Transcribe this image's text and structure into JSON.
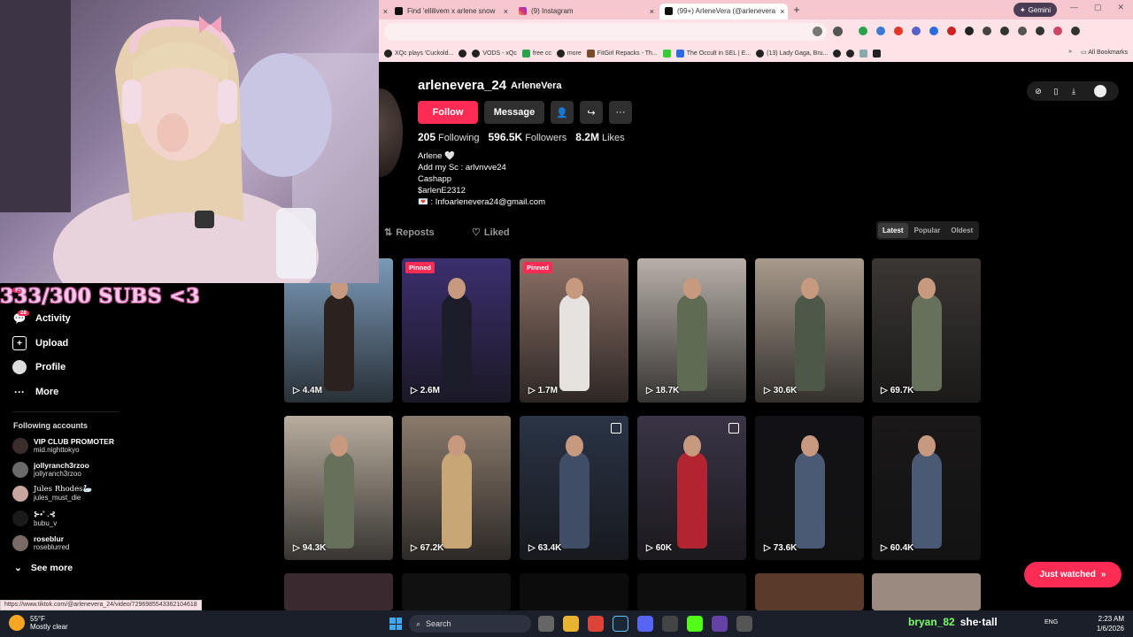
{
  "browser": {
    "tabs": [
      {
        "label": "Find 'ellilivem x arlene snow"
      },
      {
        "label": "(9) Instagram"
      },
      {
        "label": "(99+) ArleneVera (@arlenevera"
      }
    ],
    "gemini_label": "Gemini",
    "bookmarks": [
      "XQc plays 'Cuckold...",
      "VODS - xQc",
      "free cc",
      "more",
      "FitGirl Repacks - Th...",
      "The Occult in SEL | E...",
      "(13) Lady Gaga, Bru..."
    ],
    "all_bookmarks": "All Bookmarks",
    "status_url": "https://www.tiktok.com/@arlenevera_24/video/7296985543362104618"
  },
  "profile": {
    "username": "arlenevera_24",
    "nickname": "ArleneVera",
    "follow_label": "Follow",
    "message_label": "Message",
    "stats": {
      "following_count": "205",
      "following_label": "Following",
      "followers_count": "596.5K",
      "followers_label": "Followers",
      "likes_count": "8.2M",
      "likes_label": "Likes"
    },
    "bio": [
      "Arlene 🤍",
      "Add my Sc : arlvnvve24",
      "Cashapp",
      "$arlenE2312",
      "💌 : Infoarlenevera24@gmail.com"
    ],
    "tabs": {
      "reposts": "Reposts",
      "liked": "Liked"
    },
    "sort": {
      "latest": "Latest",
      "popular": "Popular",
      "oldest": "Oldest"
    }
  },
  "videos": [
    {
      "views": "4.4M",
      "pinned": "",
      "multi": false,
      "bg": "#7a9ab8",
      "fig": "#2b2220"
    },
    {
      "views": "2.6M",
      "pinned": "Pinned",
      "multi": false,
      "bg": "#3c2f6e",
      "fig": "#1c1c2a"
    },
    {
      "views": "1.7M",
      "pinned": "Pinned",
      "multi": false,
      "bg": "#8c7066",
      "fig": "#e6e2e0"
    },
    {
      "views": "18.7K",
      "pinned": "",
      "multi": false,
      "bg": "#b8b0a8",
      "fig": "#5f6b52"
    },
    {
      "views": "30.6K",
      "pinned": "",
      "multi": false,
      "bg": "#a89a8c",
      "fig": "#4e5848"
    },
    {
      "views": "69.7K",
      "pinned": "",
      "multi": false,
      "bg": "#3a3634",
      "fig": "#66705a"
    },
    {
      "views": "94.3K",
      "pinned": "",
      "multi": false,
      "bg": "#b8ad9e",
      "fig": "#66705a"
    },
    {
      "views": "67.2K",
      "pinned": "",
      "multi": false,
      "bg": "#8a7a6c",
      "fig": "#c9a676"
    },
    {
      "views": "63.4K",
      "pinned": "",
      "multi": true,
      "bg": "#2a3446",
      "fig": "#3f4e66"
    },
    {
      "views": "60K",
      "pinned": "",
      "multi": true,
      "bg": "#3a3446",
      "fig": "#b22430"
    },
    {
      "views": "73.6K",
      "pinned": "",
      "multi": false,
      "bg": "#121216",
      "fig": "#4a5a74"
    },
    {
      "views": "60.4K",
      "pinned": "",
      "multi": false,
      "bg": "#1a1818",
      "fig": "#4a5a74"
    }
  ],
  "sidebar": {
    "activity": "Activity",
    "activity_badge": "28",
    "upload": "Upload",
    "profile": "Profile",
    "more": "More",
    "messages_badge": "99+",
    "following_heading": "Following accounts",
    "accounts": [
      {
        "name": "VIP CLUB PROMOTER",
        "handle": "mid.nighttokyo"
      },
      {
        "name": "jollyranch3rzoo",
        "handle": "jollyranch3rzoo"
      },
      {
        "name": "Jules Rhodes🦢",
        "handle": "jules_must_die"
      },
      {
        "name": "⊱•˚ .⊰",
        "handle": "bubu_v"
      },
      {
        "name": "roseblur",
        "handle": "roseblurred"
      }
    ],
    "see_more": "See more"
  },
  "overlay": {
    "subs_text": "333/300 SUBS <3"
  },
  "just_watched": "Just watched",
  "taskbar": {
    "temp": "55°F",
    "weather": "Mostly clear",
    "search": "Search",
    "overlay_name1": "bryan_82",
    "overlay_name2": "she·tall",
    "lang": "ENG",
    "time": "2:23 AM",
    "date": "1/6/2026"
  }
}
